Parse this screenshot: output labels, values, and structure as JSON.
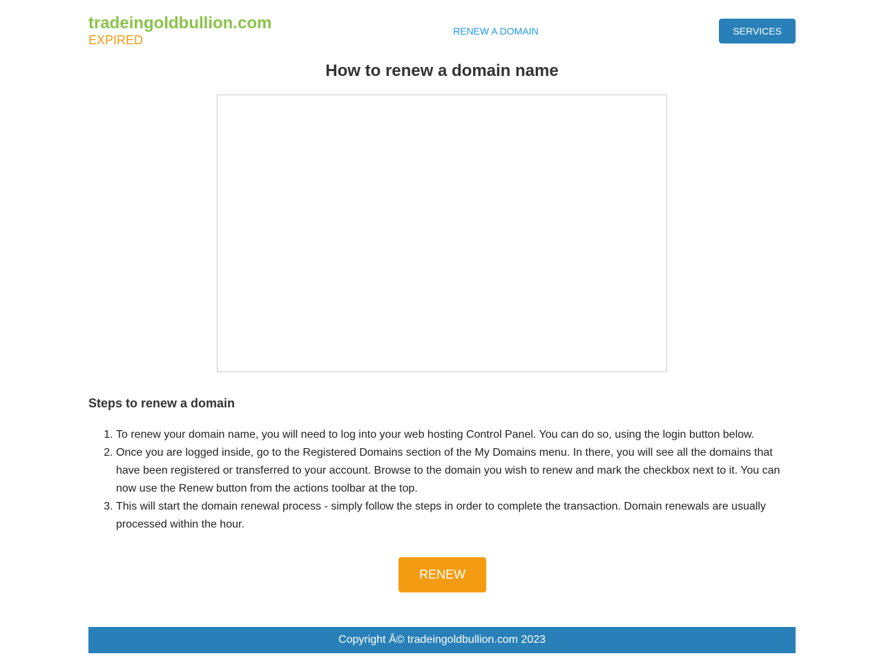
{
  "header": {
    "site_name": "tradeingoldbullion.com",
    "status": "EXPIRED",
    "nav_link": "RENEW A DOMAIN",
    "services_button": "SERVICES"
  },
  "main": {
    "title": "How to renew a domain name",
    "steps_heading": "Steps to renew a domain",
    "steps": [
      "To renew your domain name, you will need to log into your web hosting Control Panel. You can do so, using the login button below.",
      "Once you are logged inside, go to the Registered Domains section of the My Domains menu. In there, you will see all the domains that have been registered or transferred to your account. Browse to the domain you wish to renew and mark the checkbox next to it. You can now use the Renew button from the actions toolbar at the top.",
      "This will start the domain renewal process - simply follow the steps in order to complete the transaction. Domain renewals are usually processed within the hour."
    ],
    "renew_button": "RENEW"
  },
  "footer": {
    "copyright": "Copyright Â© tradeingoldbullion.com 2023"
  },
  "colors": {
    "brand_green": "#8bc34a",
    "expired_orange": "#f39c12",
    "primary_blue": "#2980b9",
    "link_blue": "#2196f3"
  }
}
